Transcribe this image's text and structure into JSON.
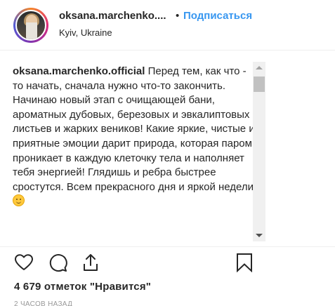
{
  "header": {
    "username": "oksana.marchenko....",
    "dot": "•",
    "follow_label": "Подписаться",
    "location": "Kyiv, Ukraine"
  },
  "caption": {
    "author": "oksana.marchenko.official",
    "text": "Перед тем, как что - то начать, сначала нужно что-то закончить. Начинаю новый этап с очищающей бани, ароматных дубовых, березовых и эвкалиптовых листьев и жарких веников! Какие яркие, чистые и приятные эмоции дарит природа, которая паром проникает в каждую клеточку тела и наполняет тебя энергией! Глядишь и ребра быстрее сростутся. Всем прекрасного дня и яркой недели",
    "emoji": "smiling-face-emoji"
  },
  "actions": {
    "like_icon": "heart-icon",
    "comment_icon": "comment-icon",
    "share_icon": "share-icon",
    "save_icon": "bookmark-icon"
  },
  "likes_text": "4 679 отметок \"Нравится\"",
  "timestamp": "2 часов назад",
  "colors": {
    "link": "#3897f0",
    "text": "#262626",
    "muted": "#999999"
  }
}
